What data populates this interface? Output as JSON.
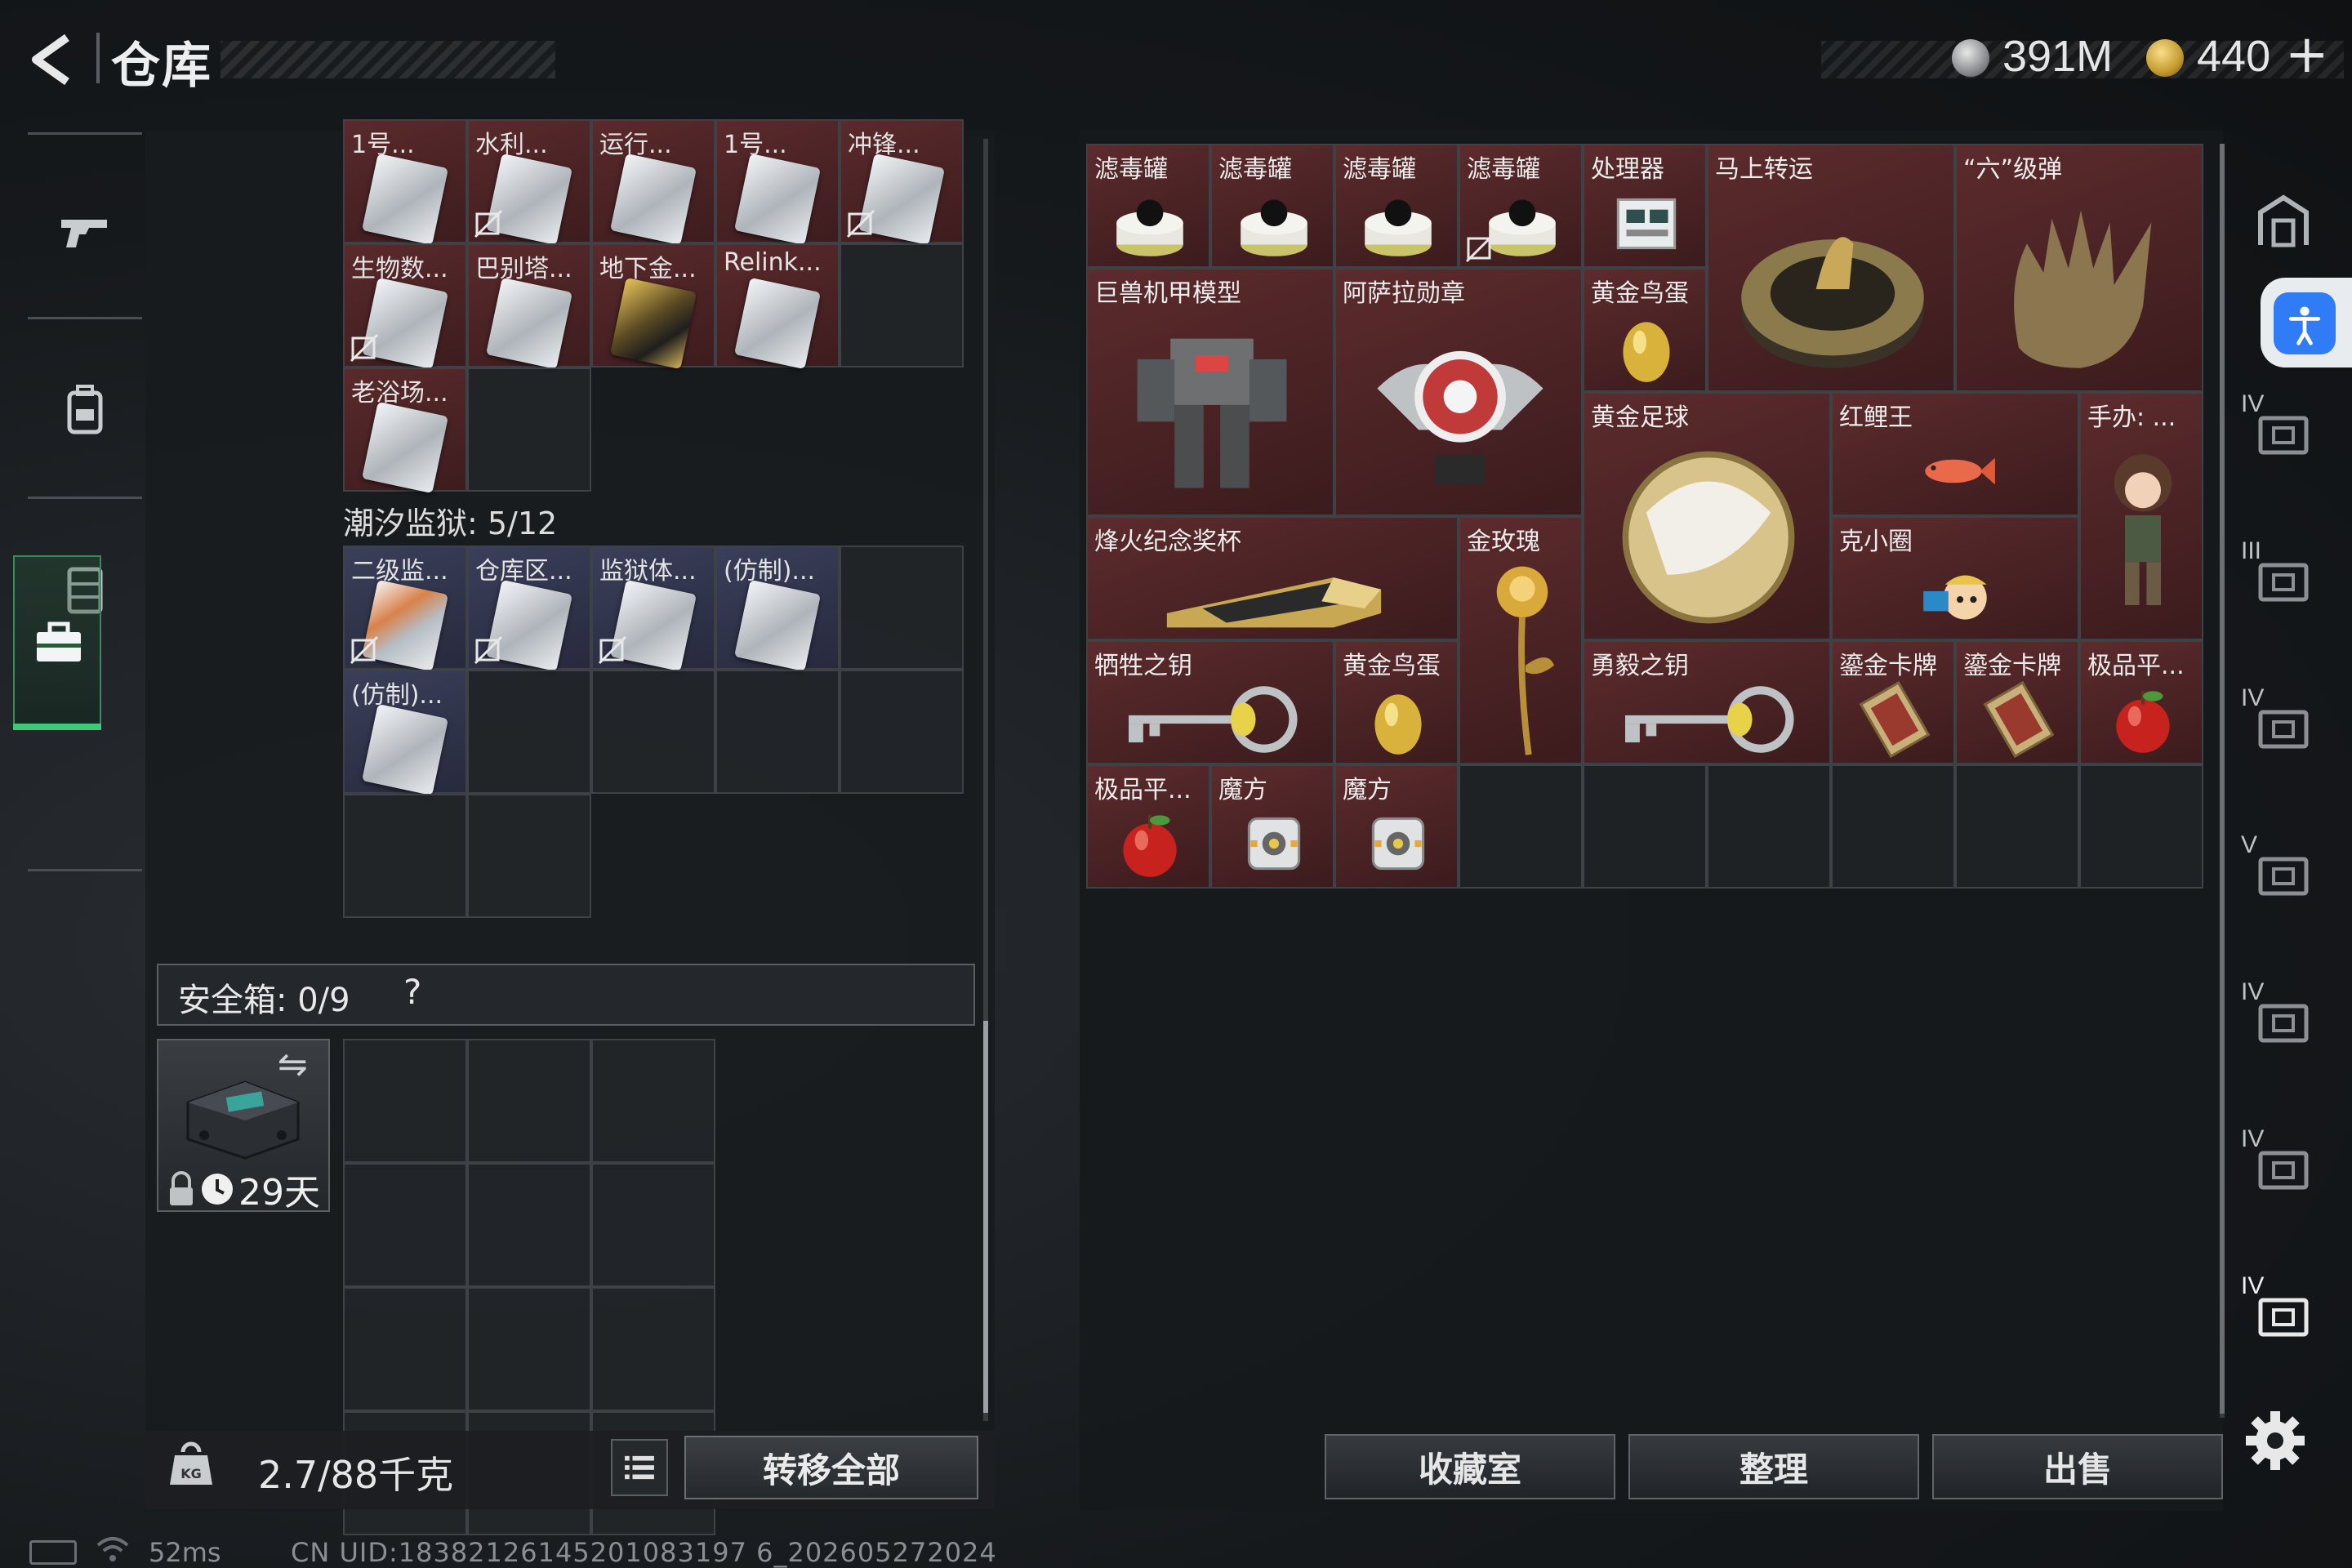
{
  "header": {
    "title": "仓库",
    "currency_silver": "391M",
    "currency_gold": "440",
    "plus_label": "+"
  },
  "left_nav": {
    "items": [
      "gun-icon",
      "backpack-icon",
      "vest-icon",
      "toolbox-icon"
    ],
    "active_index": 3
  },
  "container": {
    "rows": [
      [
        {
          "name": "1号...",
          "style": "red",
          "unbound": false
        },
        {
          "name": "水利...",
          "style": "red",
          "unbound": true
        },
        {
          "name": "运行...",
          "style": "red",
          "unbound": false
        },
        {
          "name": "1号...",
          "style": "red",
          "unbound": false
        },
        {
          "name": "冲锋...",
          "style": "red",
          "unbound": true
        }
      ],
      [
        {
          "name": "生物数...",
          "style": "red",
          "unbound": true
        },
        {
          "name": "巴别塔...",
          "style": "red",
          "unbound": false
        },
        {
          "name": "地下金...",
          "style": "red",
          "unbound": false,
          "card": "gold"
        },
        {
          "name": "Relink...",
          "style": "red",
          "unbound": false
        },
        {
          "name": "",
          "style": "empty"
        }
      ],
      [
        {
          "name": "老浴场...",
          "style": "red",
          "unbound": false
        },
        {
          "name": "",
          "style": "empty"
        }
      ]
    ],
    "section_label": "潮汐监狱: 5/12",
    "section_rows": [
      [
        {
          "name": "二级监...",
          "style": "blue",
          "unbound": true,
          "card": "orange"
        },
        {
          "name": "仓库区...",
          "style": "blue",
          "unbound": true
        },
        {
          "name": "监狱体...",
          "style": "blue",
          "unbound": true
        },
        {
          "name": "(仿制)...",
          "style": "blue",
          "unbound": false
        },
        {
          "name": "",
          "style": "empty"
        }
      ],
      [
        {
          "name": "(仿制)...",
          "style": "blue",
          "unbound": false
        },
        {
          "name": "",
          "style": "empty"
        },
        {
          "name": "",
          "style": "empty"
        },
        {
          "name": "",
          "style": "empty"
        },
        {
          "name": "",
          "style": "empty"
        }
      ],
      [
        {
          "name": "",
          "style": "empty"
        },
        {
          "name": "",
          "style": "empty"
        }
      ]
    ]
  },
  "safe_box": {
    "label": "安全箱: 0/9",
    "help": "?",
    "swap": "⇋",
    "days": "29天"
  },
  "footer_left": {
    "weight": "2.7/88千克",
    "transfer_all": "转移全部"
  },
  "stash_items": [
    {
      "id": "filter1",
      "name": "滤毒罐",
      "art": "canister"
    },
    {
      "id": "filter2",
      "name": "滤毒罐",
      "art": "canister"
    },
    {
      "id": "filter3",
      "name": "滤毒罐",
      "art": "canister"
    },
    {
      "id": "filter4",
      "name": "滤毒罐",
      "art": "canister",
      "unbound": true
    },
    {
      "id": "processor",
      "name": "处理器",
      "art": "processor"
    },
    {
      "id": "mashang",
      "name": "马上转运",
      "art": "coin"
    },
    {
      "id": "liuji",
      "name": "“六”级弹",
      "art": "glove"
    },
    {
      "id": "mecha",
      "name": "巨兽机甲模型",
      "art": "mecha"
    },
    {
      "id": "medal",
      "name": "阿萨拉勋章",
      "art": "medal"
    },
    {
      "id": "egg1",
      "name": "黄金鸟蛋",
      "art": "egg"
    },
    {
      "id": "football",
      "name": "黄金足球",
      "art": "football"
    },
    {
      "id": "carp",
      "name": "红鲤王",
      "art": "fish"
    },
    {
      "id": "figure",
      "name": "手办: ...",
      "art": "figure"
    },
    {
      "id": "trophy",
      "name": "烽火纪念奖杯",
      "art": "trophy"
    },
    {
      "id": "rose",
      "name": "金玫瑰",
      "art": "rose"
    },
    {
      "id": "kexiao",
      "name": "克小圈",
      "art": "toy"
    },
    {
      "id": "key1",
      "name": "牺牲之钥",
      "art": "key"
    },
    {
      "id": "egg2",
      "name": "黄金鸟蛋",
      "art": "egg"
    },
    {
      "id": "key2",
      "name": "勇毅之钥",
      "art": "key"
    },
    {
      "id": "plate1",
      "name": "鎏金卡牌",
      "art": "plate"
    },
    {
      "id": "plate2",
      "name": "鎏金卡牌",
      "art": "plate"
    },
    {
      "id": "apple1",
      "name": "极品平...",
      "art": "apple"
    },
    {
      "id": "apple2",
      "name": "极品平...",
      "art": "apple"
    },
    {
      "id": "cube1",
      "name": "魔方",
      "art": "cube"
    },
    {
      "id": "cube2",
      "name": "魔方",
      "art": "cube"
    }
  ],
  "bottom_buttons": {
    "collection": "收藏室",
    "sort": "整理",
    "sell": "出售"
  },
  "right_sidebar": {
    "tiers": [
      "IV",
      "III",
      "IV",
      "V",
      "IV",
      "IV",
      "IV"
    ]
  },
  "status": {
    "ping": "52ms",
    "uid": "CN UID:18382126145201083197 6_202605272024"
  }
}
